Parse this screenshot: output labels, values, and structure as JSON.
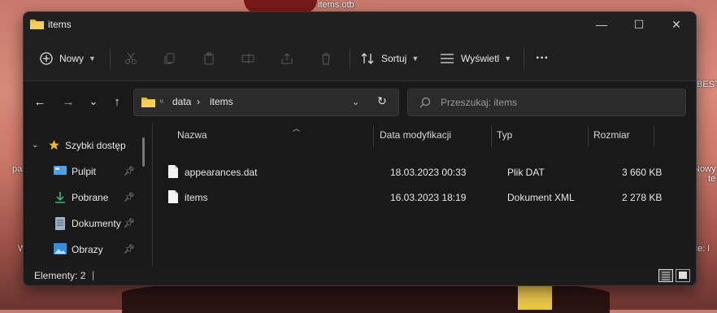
{
  "desktop": {
    "top_label": "items.otb",
    "right_label_1": "BEST",
    "left_label_1": "pa",
    "right_label_2": "Nowy",
    "right_label_3": "te",
    "left_label_2": "W",
    "right_label_4": "ue: l"
  },
  "window": {
    "title": "items",
    "controls": {
      "minimize": "—",
      "maximize": "☐",
      "close": "✕"
    }
  },
  "toolbar": {
    "new_label": "Nowy",
    "sort_label": "Sortuj",
    "view_label": "Wyświetl",
    "more_label": "···"
  },
  "navigation": {
    "back": "←",
    "forward": "→",
    "recent": "⌄",
    "up": "↑",
    "refresh": "↻"
  },
  "address": {
    "overflow": "«",
    "segments": [
      "data",
      "items"
    ],
    "separator": "›"
  },
  "search": {
    "placeholder": "Przeszukaj: items"
  },
  "sidebar": {
    "items": [
      {
        "label": "Szybki dostęp",
        "icon": "star-icon"
      },
      {
        "label": "Pulpit",
        "icon": "desktop-icon"
      },
      {
        "label": "Pobrane",
        "icon": "download-icon"
      },
      {
        "label": "Dokumenty",
        "icon": "document-icon"
      },
      {
        "label": "Obrazy",
        "icon": "image-icon"
      }
    ]
  },
  "table": {
    "columns": [
      "Nazwa",
      "Data modyfikacji",
      "Typ",
      "Rozmiar"
    ],
    "rows": [
      {
        "name": "appearances.dat",
        "modified": "18.03.2023 00:33",
        "type": "Plik DAT",
        "size": "3 660 KB"
      },
      {
        "name": "items",
        "modified": "16.03.2023 18:19",
        "type": "Dokument XML",
        "size": "2 278 KB"
      }
    ]
  },
  "status": {
    "items_count": "Elementy: 2",
    "cursor": "|"
  },
  "colors": {
    "window_bg": "#1c1c1c",
    "folder": "#e8b931",
    "star": "#f2c01e",
    "accent_blue": "#4aa3e8",
    "download_green": "#3fb37f"
  }
}
